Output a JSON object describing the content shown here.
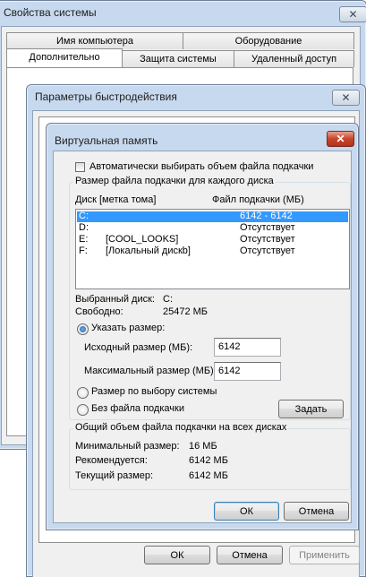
{
  "system_props": {
    "title": "Свойства системы",
    "tabs_back": [
      "Имя компьютера",
      "Оборудование"
    ],
    "tabs_front": [
      "Дополнительно",
      "Защита системы",
      "Удаленный доступ"
    ]
  },
  "performance": {
    "title": "Параметры быстродействия",
    "buttons": {
      "ok": "ОК",
      "cancel": "Отмена",
      "apply": "Применить"
    }
  },
  "virtual_memory": {
    "title": "Виртуальная память",
    "auto_checkbox_label": "Автоматически выбирать объем файла подкачки",
    "auto_checked": false,
    "per_disk_group": "Размер файла подкачки для каждого диска",
    "columns": {
      "disk": "Диск [метка тома]",
      "pagefile": "Файл подкачки (МБ)"
    },
    "drives": [
      {
        "letter": "C:",
        "label": "",
        "pagefile": "6142 - 6142",
        "selected": true
      },
      {
        "letter": "D:",
        "label": "",
        "pagefile": "Отсутствует",
        "selected": false
      },
      {
        "letter": "E:",
        "label": "[COOL_LOOKS]",
        "pagefile": "Отсутствует",
        "selected": false
      },
      {
        "letter": "F:",
        "label": "[Локальный дискb]",
        "pagefile": "Отсутствует",
        "selected": false
      }
    ],
    "selected_disk_label": "Выбранный диск:",
    "selected_disk_value": "C:",
    "free_label": "Свободно:",
    "free_value": "25472 МБ",
    "custom_size_label": "Указать размер:",
    "initial_size_label": "Исходный размер (МБ):",
    "initial_size_value": "6142",
    "max_size_label": "Максимальный размер (МБ):",
    "max_size_value": "6142",
    "system_managed_label": "Размер по выбору системы",
    "no_pagefile_label": "Без файла подкачки",
    "set_button": "Задать",
    "totals_group": "Общий объем файла подкачки на всех дисках",
    "min_label": "Минимальный размер:",
    "min_value": "16 МБ",
    "recommended_label": "Рекомендуется:",
    "recommended_value": "6142 МБ",
    "current_label": "Текущий размер:",
    "current_value": "6142 МБ",
    "ok": "ОК",
    "cancel": "Отмена"
  }
}
